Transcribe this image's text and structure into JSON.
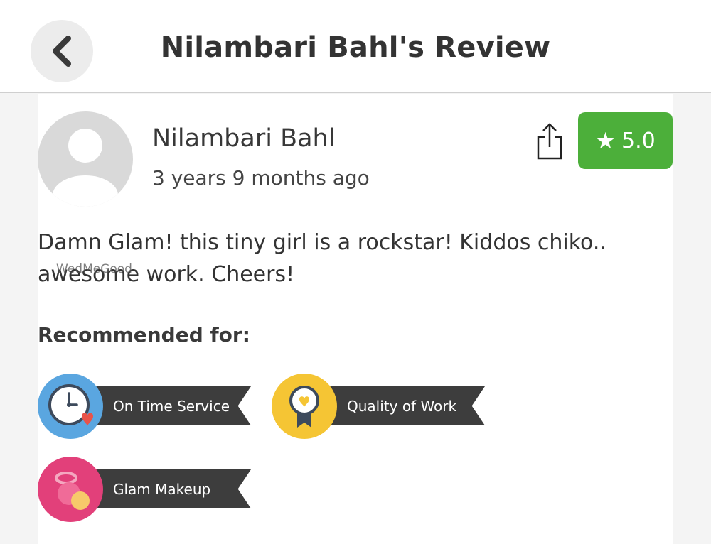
{
  "header": {
    "title": "Nilambari Bahl's Review",
    "back_icon": "chevron-left-icon"
  },
  "review": {
    "author": "Nilambari Bahl",
    "time_ago": "3 years 9 months ago",
    "rating": "5.0",
    "rating_color": "#4caf3a",
    "text": "Damn Glam! this tiny girl is a rockstar! Kiddos chiko.. awesome work. Cheers!",
    "watermark": "WedMeGood"
  },
  "recommended": {
    "label": "Recommended for:",
    "items": [
      {
        "label": "On Time Service",
        "icon": "clock-heart-icon",
        "color": "#5aa6e0"
      },
      {
        "label": "Quality of Work",
        "icon": "award-ribbon-icon",
        "color": "#f5c534"
      },
      {
        "label": "Glam Makeup",
        "icon": "makeup-compact-icon",
        "color": "#e2407a"
      }
    ]
  }
}
